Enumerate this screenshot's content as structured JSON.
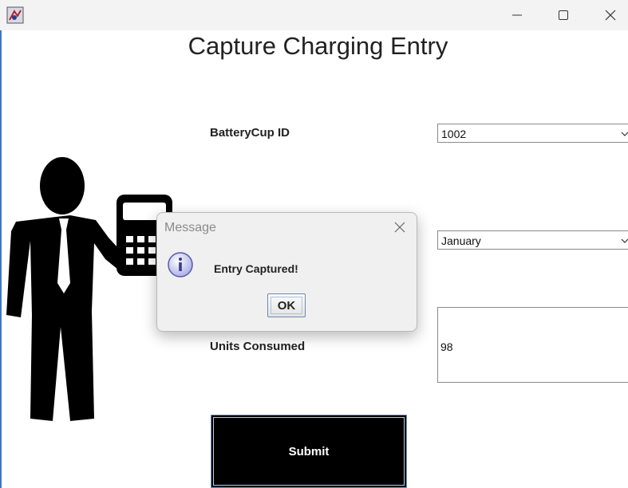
{
  "window": {
    "minimize_icon": "minimize-icon",
    "maximize_icon": "maximize-icon",
    "close_icon": "close-icon",
    "app_icon": "java-app-icon"
  },
  "page": {
    "title": "Capture Charging Entry"
  },
  "form": {
    "batterycup_label": "BatteryCup ID",
    "batterycup_value": "1002",
    "month_value": "January",
    "units_label": "Units Consumed",
    "units_value": "98",
    "submit_label": "Submit"
  },
  "dialog": {
    "title": "Message",
    "message": "Entry Captured!",
    "ok_label": "OK",
    "icon": "info-icon"
  },
  "colors": {
    "accent_edge": "#3a78c9",
    "submit_bg": "#000000",
    "dialog_bg": "#f0f0f0"
  }
}
